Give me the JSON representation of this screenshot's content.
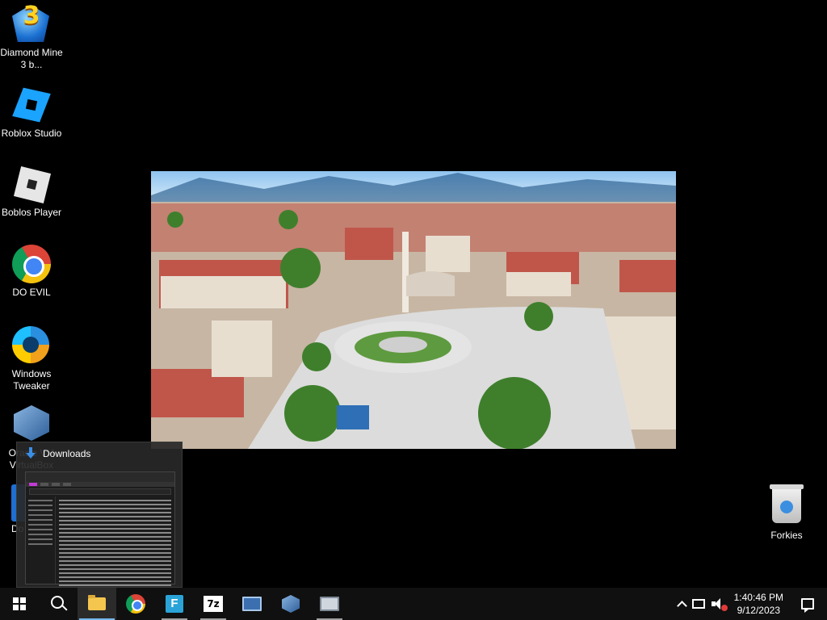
{
  "desktop": {
    "icons": [
      {
        "label": "Diamond Mine 3 b...",
        "glyph": "diamond-mine-icon",
        "badge": "3"
      },
      {
        "label": "Roblox Studio",
        "glyph": "roblox-studio-icon"
      },
      {
        "label": "Boblos Player",
        "glyph": "roblox-player-icon"
      },
      {
        "label": "DO EVIL",
        "glyph": "chrome-icon"
      },
      {
        "label": "Windows Tweaker",
        "glyph": "windows-tweaker-icon"
      },
      {
        "label": "Oracle VM VirtualBox",
        "glyph": "virtualbox-icon"
      },
      {
        "label": "Do",
        "glyph": "app-icon"
      }
    ],
    "recycle_bin": {
      "label": "Forkies",
      "glyph": "recycle-bin-icon"
    }
  },
  "thumbnail": {
    "title": "Downloads",
    "glyph": "download-arrow-icon"
  },
  "taskbar": {
    "apps": [
      {
        "name": "start",
        "glyph": "windows-logo-icon"
      },
      {
        "name": "search",
        "glyph": "search-icon"
      },
      {
        "name": "file-explorer",
        "glyph": "folder-icon"
      },
      {
        "name": "chrome",
        "glyph": "chrome-icon"
      },
      {
        "name": "flash",
        "glyph": "flash-player-icon",
        "text": "F"
      },
      {
        "name": "7zip",
        "glyph": "7zip-icon",
        "text": "7z"
      },
      {
        "name": "monitor",
        "glyph": "monitor-icon"
      },
      {
        "name": "virtualbox",
        "glyph": "virtualbox-icon"
      },
      {
        "name": "remote-desktop",
        "glyph": "remote-desktop-icon"
      }
    ],
    "tray": {
      "time": "1:40:46 PM",
      "date": "9/12/2023"
    }
  },
  "colors": {
    "accent": "#76b9ed",
    "taskbar_bg": "#101010",
    "desktop_bg": "#000000"
  }
}
